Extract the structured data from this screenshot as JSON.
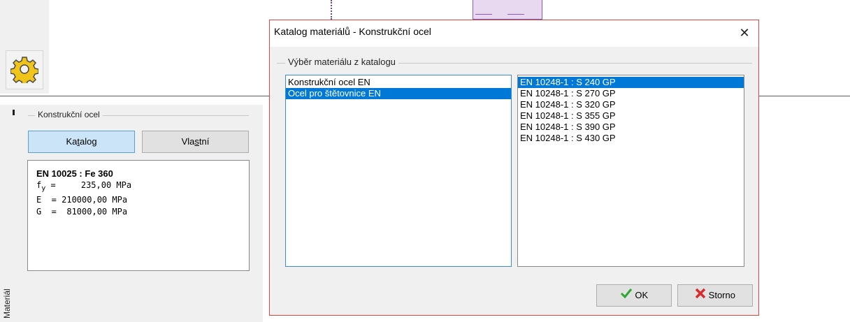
{
  "panel": {
    "group_label": "Konstrukční ocel",
    "katalog_pre": "Ka",
    "katalog_u": "t",
    "katalog_post": "alog",
    "vlastni_pre": "Vla",
    "vlastni_u": "s",
    "vlastni_post": "tní",
    "material_name": "EN 10025 : Fe 360",
    "props": {
      "fy_sym": "f",
      "fy_sub": "y",
      "fy_rest": " =     235,00 MPa",
      "e_line": "E  = 210000,00 MPa",
      "g_line": "G  =  81000,00 MPa"
    },
    "side_tab_label": "Materiál"
  },
  "dialog": {
    "title": "Katalog materiálů - Konstrukční ocel",
    "close_glyph": "✕",
    "group_label": "Výběr materiálu z katalogu",
    "categories": [
      {
        "label": "Konstrukční ocel EN",
        "selected": false
      },
      {
        "label": "Ocel pro štětovnice EN",
        "selected": true
      }
    ],
    "materials": [
      {
        "label": "EN 10248-1 : S 240 GP",
        "selected": true
      },
      {
        "label": "EN 10248-1 : S 270 GP",
        "selected": false
      },
      {
        "label": "EN 10248-1 : S 320 GP",
        "selected": false
      },
      {
        "label": "EN 10248-1 : S 355 GP",
        "selected": false
      },
      {
        "label": "EN 10248-1 : S 390 GP",
        "selected": false
      },
      {
        "label": "EN 10248-1 : S 430 GP",
        "selected": false
      }
    ],
    "ok_label": "OK",
    "storno_label": "Storno"
  },
  "icons": {
    "settings": "gear-icon",
    "ok": "checkmark-icon",
    "storno": "x-icon",
    "close": "close-icon"
  },
  "colors": {
    "selection": "#0078d7",
    "dialog_border": "#e04444",
    "ok_icon": "#2fa82f",
    "storno_icon": "#d92b2b"
  }
}
